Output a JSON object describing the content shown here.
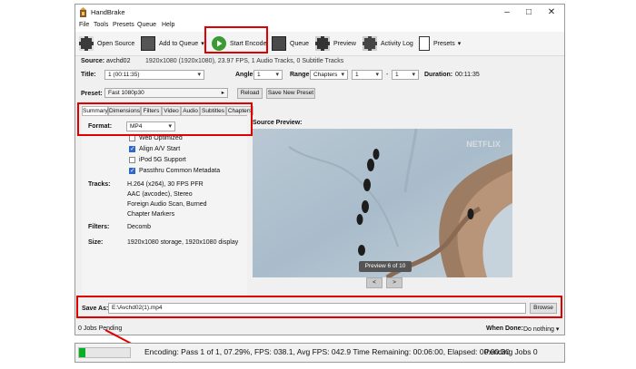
{
  "window": {
    "title": "HandBrake"
  },
  "menu": [
    "File",
    "Tools",
    "Presets",
    "Queue",
    "Help"
  ],
  "toolbar": {
    "open_source": "Open Source",
    "add_to_queue": "Add to Queue",
    "start_encode": "Start Encode",
    "queue": "Queue",
    "preview": "Preview",
    "activity_log": "Activity Log",
    "presets": "Presets"
  },
  "source": {
    "label": "Source:",
    "value": "avchd02",
    "info": "1920x1080 (1920x1080), 23.97 FPS, 1 Audio Tracks, 0 Subtitle Tracks"
  },
  "title_row": {
    "title_label": "Title:",
    "title_value": "1 (00:11:35)",
    "angle_label": "Angle:",
    "angle_value": "1",
    "range_label": "Range:",
    "range_mode": "Chapters",
    "range_start": "1",
    "range_sep": "-",
    "range_end": "1",
    "duration_label": "Duration:",
    "duration_value": "00:11:35"
  },
  "preset": {
    "label": "Preset:",
    "value": "Fast 1080p30",
    "reload": "Reload",
    "save_new": "Save New Preset"
  },
  "tabs": [
    "Summary",
    "Dimensions",
    "Filters",
    "Video",
    "Audio",
    "Subtitles",
    "Chapters"
  ],
  "summary": {
    "format_label": "Format:",
    "format_value": "MP4",
    "options": [
      {
        "label": "Web Optimized",
        "checked": false
      },
      {
        "label": "Align A/V Start",
        "checked": true
      },
      {
        "label": "iPod 5G Support",
        "checked": false
      },
      {
        "label": "Passthru Common Metadata",
        "checked": true
      }
    ],
    "tracks_label": "Tracks:",
    "tracks": [
      "H.264 (x264), 30 FPS PFR",
      "AAC (avcodec), Stereo",
      "Foreign Audio Scan, Burned",
      "Chapter Markers"
    ],
    "filters_label": "Filters:",
    "filters_value": "Decomb",
    "size_label": "Size:",
    "size_value": "1920x1080 storage, 1920x1080 display"
  },
  "preview": {
    "label": "Source Preview:",
    "watermark": "NETFLIX",
    "counter": "Preview 6 of 10",
    "prev": "<",
    "next": ">"
  },
  "save_as": {
    "label": "Save As:",
    "value": "E:\\Avchd02(1).mp4",
    "browse": "Browse"
  },
  "footer": {
    "jobs_pending": "0 Jobs Pending",
    "when_done_label": "When Done:",
    "when_done_value": "Do nothing"
  },
  "status": {
    "progress": 0.0729,
    "text": "Encoding: Pass 1 of 1,  07.29%, FPS: 038.1,  Avg FPS: 042.9 Time Remaining: 00:06:00,  Elapsed: 00:00:30",
    "pending": "Pending Jobs 0"
  },
  "colors": {
    "highlight": "#e00000",
    "progress": "#06b025",
    "checkbox": "#2b68c7"
  }
}
